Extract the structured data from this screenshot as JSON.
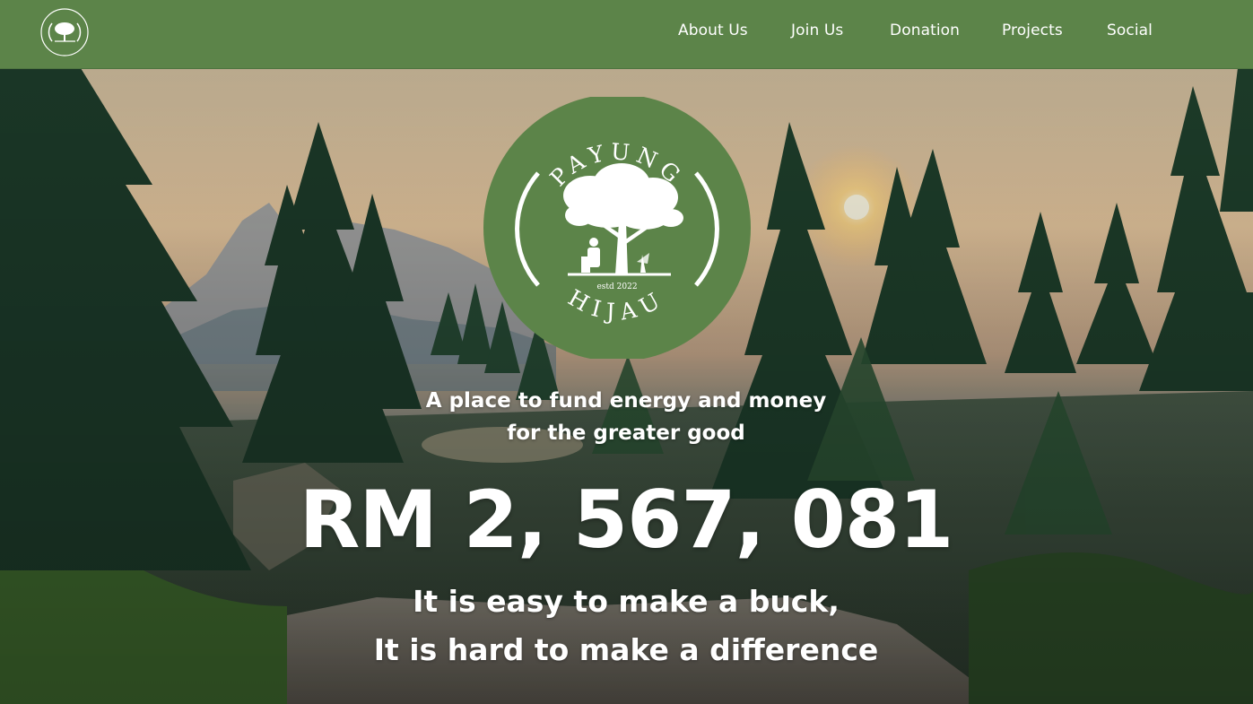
{
  "brand": {
    "logo_top_text": "PAYUNG",
    "logo_bottom_text": "HIJAU",
    "logo_estd": "estd 2022",
    "color": "#5c8449"
  },
  "nav": {
    "items": [
      {
        "label": "About Us"
      },
      {
        "label": "Join Us"
      },
      {
        "label": "Donation"
      },
      {
        "label": "Projects"
      },
      {
        "label": "Social"
      }
    ]
  },
  "hero": {
    "tagline_line1": "A place to fund energy and money",
    "tagline_line2": "for the greater good",
    "amount": "RM 2, 567, 081",
    "motto_line1": "It is easy to make a buck,",
    "motto_line2": "It is hard to make a difference"
  }
}
